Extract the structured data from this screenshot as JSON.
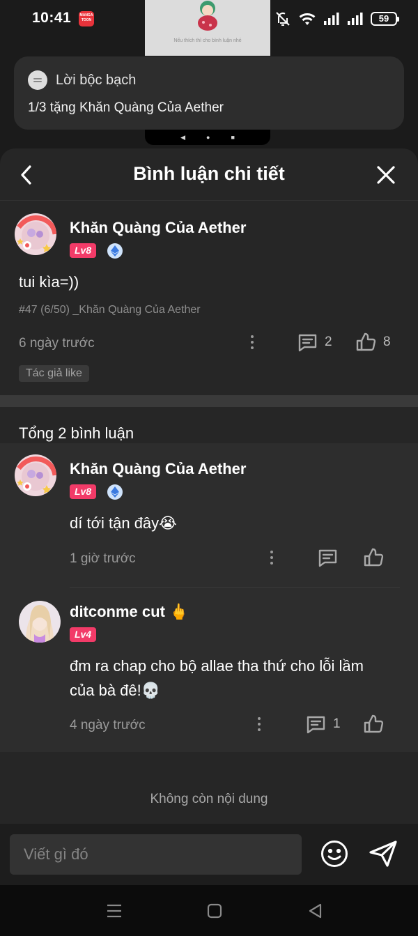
{
  "status_bar": {
    "time": "10:41",
    "app_icon_text": "MANGA TOON",
    "battery": "59"
  },
  "pip": {
    "caption": "Nếu thích thì cho bình luận nhé"
  },
  "notification": {
    "app_name": "Lời bộc bạch",
    "text": "1/3 tặng Khăn Quàng Của Aether"
  },
  "sheet": {
    "title": "Bình luận chi tiết"
  },
  "main_comment": {
    "username": "Khăn Quàng Của Aether",
    "level": "Lv8",
    "text": "tui kìa=))",
    "meta": "#47 (6/50) _Khăn Quàng Của Aether",
    "time": "6 ngày trước",
    "reply_count": "2",
    "like_count": "8",
    "author_tag": "Tác giả like"
  },
  "replies_header": {
    "total": "Tổng 2 bình luận"
  },
  "replies": [
    {
      "username": "Khăn Quàng Của Aether",
      "level": "Lv8",
      "text": "dí tới tận đây😭",
      "time": "1 giờ trước",
      "reply_count": "",
      "like_count": ""
    },
    {
      "username": "ditconme cut 🖕",
      "level": "Lv4",
      "text": "đm ra chap cho bộ allae tha thứ cho lỗi lầm của bà đê!💀",
      "time": "4 ngày trước",
      "reply_count": "1",
      "like_count": ""
    }
  ],
  "footer": {
    "no_more": "Không còn nội dung",
    "input_placeholder": "Viết gì đó"
  },
  "icons": {
    "back": "chevron-left-icon",
    "close": "close-icon",
    "more": "more-vertical-icon",
    "reply": "comment-icon",
    "like": "thumbs-up-icon",
    "emoji": "smiley-icon",
    "send": "send-icon",
    "verified": "ethereum-badge-icon"
  },
  "colors": {
    "level_badge": "#f23b68",
    "background": "#262626",
    "card": "#2d2d2d"
  }
}
